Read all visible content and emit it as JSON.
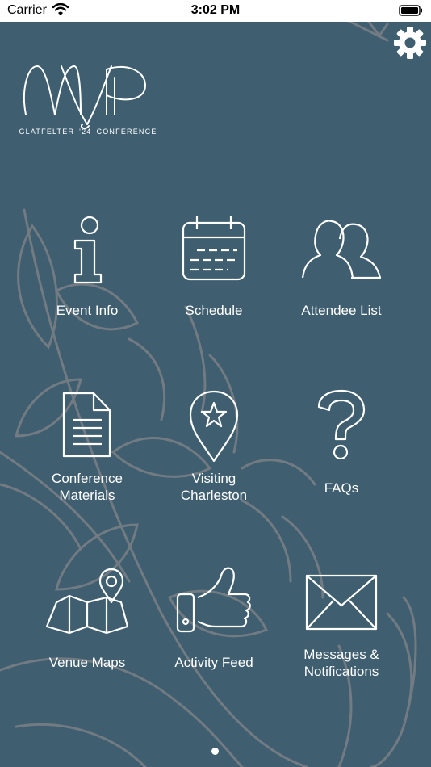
{
  "status": {
    "carrier": "Carrier",
    "time": "3:02 PM"
  },
  "logo": {
    "monogram": "MVP",
    "left_text": "GLATFELTER",
    "year": "'24",
    "right_text": "CONFERENCE"
  },
  "tiles": [
    {
      "label": "Event Info",
      "icon": "info-icon"
    },
    {
      "label": "Schedule",
      "icon": "calendar-icon"
    },
    {
      "label": "Attendee List",
      "icon": "people-icon"
    },
    {
      "label_line1": "Conference",
      "label_line2": "Materials",
      "icon": "document-icon"
    },
    {
      "label_line1": "Visiting",
      "label_line2": "Charleston",
      "icon": "map-pin-star-icon"
    },
    {
      "label": "FAQs",
      "icon": "question-icon"
    },
    {
      "label": "Venue Maps",
      "icon": "folded-map-icon"
    },
    {
      "label": "Activity Feed",
      "icon": "thumbs-up-icon"
    },
    {
      "label_line1": "Messages &",
      "label_line2": "Notifications",
      "icon": "envelope-icon"
    }
  ],
  "colors": {
    "background": "#3f5f71",
    "icon": "#ffffff",
    "foliage": "#7b7f86"
  },
  "page_indicator": {
    "current": 1,
    "total": 1
  }
}
